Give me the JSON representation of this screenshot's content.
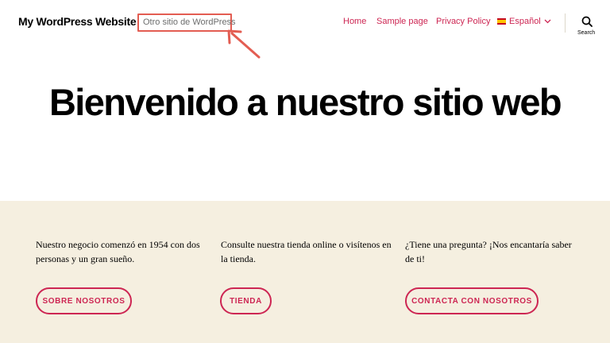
{
  "header": {
    "site_title": "My WordPress Website",
    "tagline": "Otro sitio de WordPress",
    "nav": {
      "home": "Home",
      "sample": "Sample page",
      "privacy": "Privacy Policy",
      "language": "Español"
    },
    "search_label": "Search"
  },
  "hero": {
    "title": "Bienvenido a nuestro sitio web"
  },
  "columns": [
    {
      "text": "Nuestro negocio comenzó en 1954 con dos personas y un gran sueño.",
      "button": "Sobre nosotros"
    },
    {
      "text": "Consulte nuestra tienda online o visítenos en la tienda.",
      "button": "Tienda"
    },
    {
      "text": "¿Tiene una pregunta? ¡Nos encantaría saber de ti!",
      "button": "Contacta con nosotros"
    }
  ],
  "colors": {
    "accent": "#cd2653",
    "annotation": "#e35d52",
    "band_background": "#f5efe0",
    "tagline": "#6d6d6d"
  },
  "icons": {
    "search": "search-icon",
    "language_flag": "spain-flag-icon",
    "dropdown": "chevron-down-icon",
    "annotation": "arrow-icon"
  }
}
